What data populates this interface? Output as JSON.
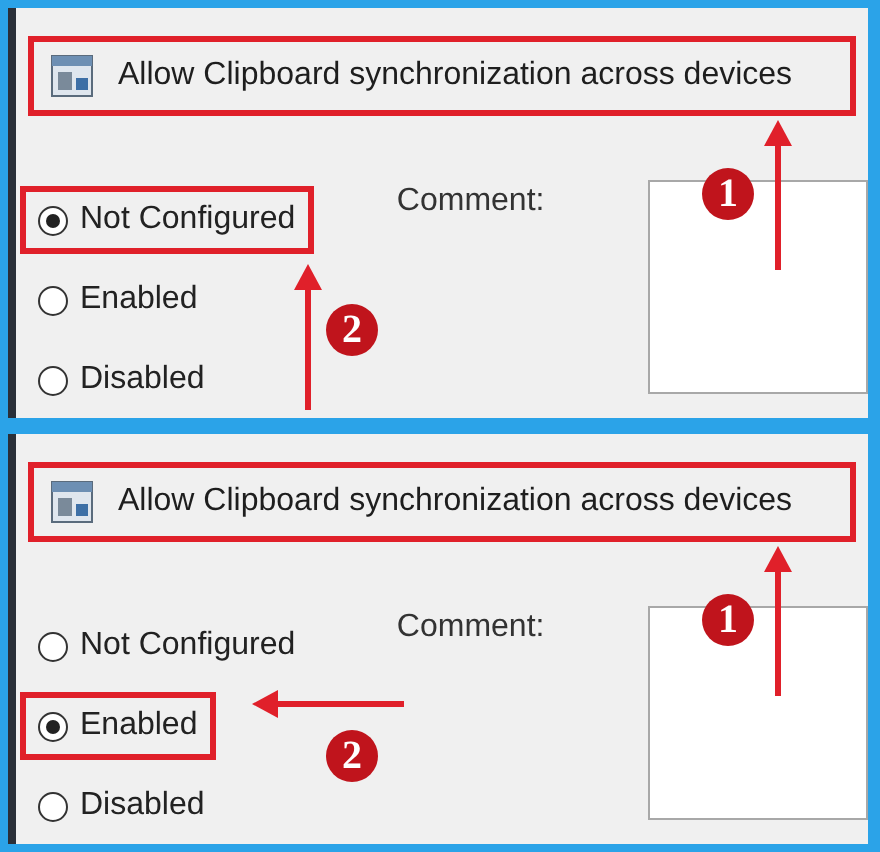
{
  "panels": [
    {
      "title": "Allow Clipboard synchronization across devices",
      "options": [
        {
          "label": "Not Configured",
          "selected": true
        },
        {
          "label": "Enabled",
          "selected": false
        },
        {
          "label": "Disabled",
          "selected": false
        }
      ],
      "comment_label": "Comment:",
      "callouts": [
        {
          "number": "1",
          "kind": "up"
        },
        {
          "number": "2",
          "kind": "up"
        }
      ]
    },
    {
      "title": "Allow Clipboard synchronization across devices",
      "options": [
        {
          "label": "Not Configured",
          "selected": false
        },
        {
          "label": "Enabled",
          "selected": true
        },
        {
          "label": "Disabled",
          "selected": false
        }
      ],
      "comment_label": "Comment:",
      "callouts": [
        {
          "number": "1",
          "kind": "up"
        },
        {
          "number": "2",
          "kind": "left"
        }
      ]
    }
  ]
}
